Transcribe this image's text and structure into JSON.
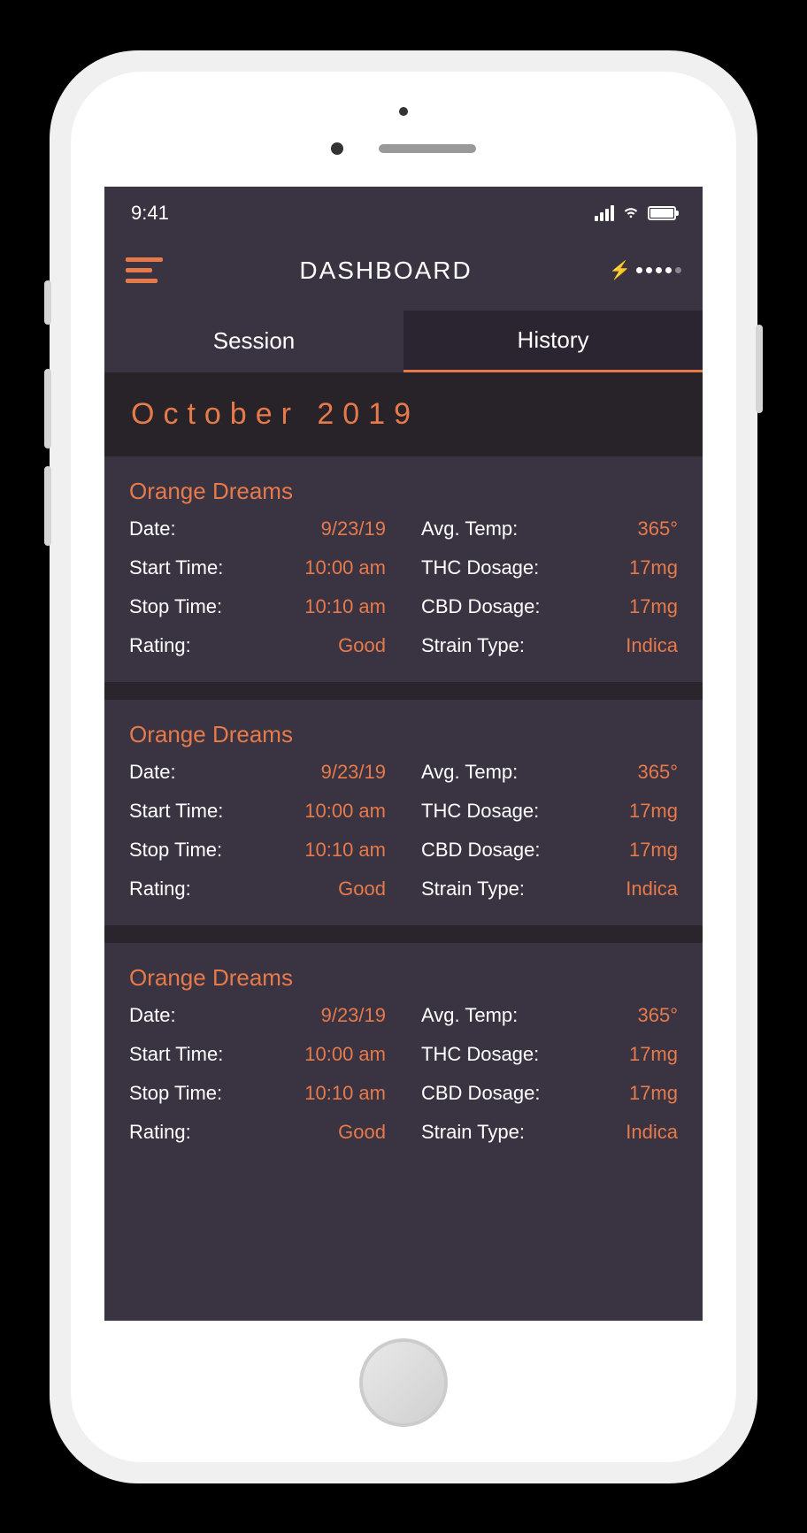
{
  "status_bar": {
    "time": "9:41"
  },
  "header": {
    "title": "DASHBOARD"
  },
  "tabs": [
    {
      "label": "Session",
      "active": false
    },
    {
      "label": "History",
      "active": true
    }
  ],
  "month_label": "October 2019",
  "labels": {
    "date": "Date:",
    "start_time": "Start Time:",
    "stop_time": "Stop Time:",
    "rating": "Rating:",
    "avg_temp": "Avg. Temp:",
    "thc_dosage": "THC Dosage:",
    "cbd_dosage": "CBD Dosage:",
    "strain_type": "Strain Type:"
  },
  "cards": [
    {
      "title": "Orange Dreams",
      "date": "9/23/19",
      "start_time": "10:00 am",
      "stop_time": "10:10 am",
      "rating": "Good",
      "avg_temp": "365°",
      "thc_dosage": "17mg",
      "cbd_dosage": "17mg",
      "strain_type": "Indica"
    },
    {
      "title": "Orange Dreams",
      "date": "9/23/19",
      "start_time": "10:00 am",
      "stop_time": "10:10 am",
      "rating": "Good",
      "avg_temp": "365°",
      "thc_dosage": "17mg",
      "cbd_dosage": "17mg",
      "strain_type": "Indica"
    },
    {
      "title": "Orange Dreams",
      "date": "9/23/19",
      "start_time": "10:00 am",
      "stop_time": "10:10 am",
      "rating": "Good",
      "avg_temp": "365°",
      "thc_dosage": "17mg",
      "cbd_dosage": "17mg",
      "strain_type": "Indica"
    }
  ],
  "colors": {
    "accent": "#e67a4b",
    "background": "#3a3342",
    "background_dark": "#2a2530"
  }
}
